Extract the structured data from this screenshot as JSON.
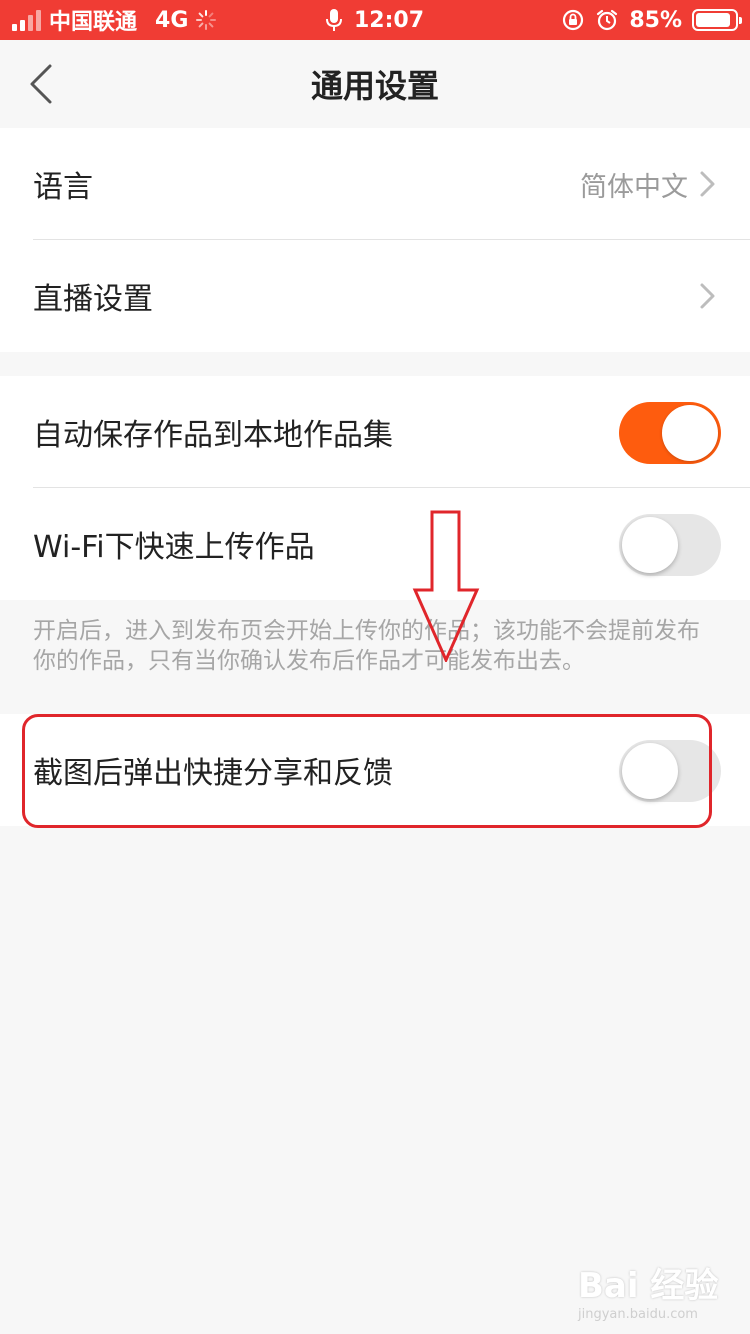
{
  "status_bar": {
    "carrier": "中国联通",
    "network": "4G",
    "time": "12:07",
    "battery": "85%",
    "battery_level": 0.85
  },
  "nav": {
    "title": "通用设置",
    "back_icon": "chevron-left-icon"
  },
  "section1": {
    "rows": [
      {
        "label": "语言",
        "value": "简体中文"
      },
      {
        "label": "直播设置",
        "value": ""
      }
    ]
  },
  "section2": {
    "rows": [
      {
        "label": "自动保存作品到本地作品集",
        "enabled": true
      },
      {
        "label": "Wi-Fi下快速上传作品",
        "enabled": false
      }
    ],
    "hint": "开启后，进入到发布页会开始上传你的作品；该功能不会提前发布你的作品，只有当你确认发布后作品才可能发布出去。"
  },
  "section3": {
    "rows": [
      {
        "label": "截图后弹出快捷分享和反馈",
        "enabled": false
      }
    ]
  },
  "colors": {
    "status_bar": "#f03c34",
    "toggle_on": "#fe5c0e",
    "annotation": "#e0262b"
  },
  "watermark": {
    "main": "Bai 经验",
    "sub": "jingyan.baidu.com"
  }
}
